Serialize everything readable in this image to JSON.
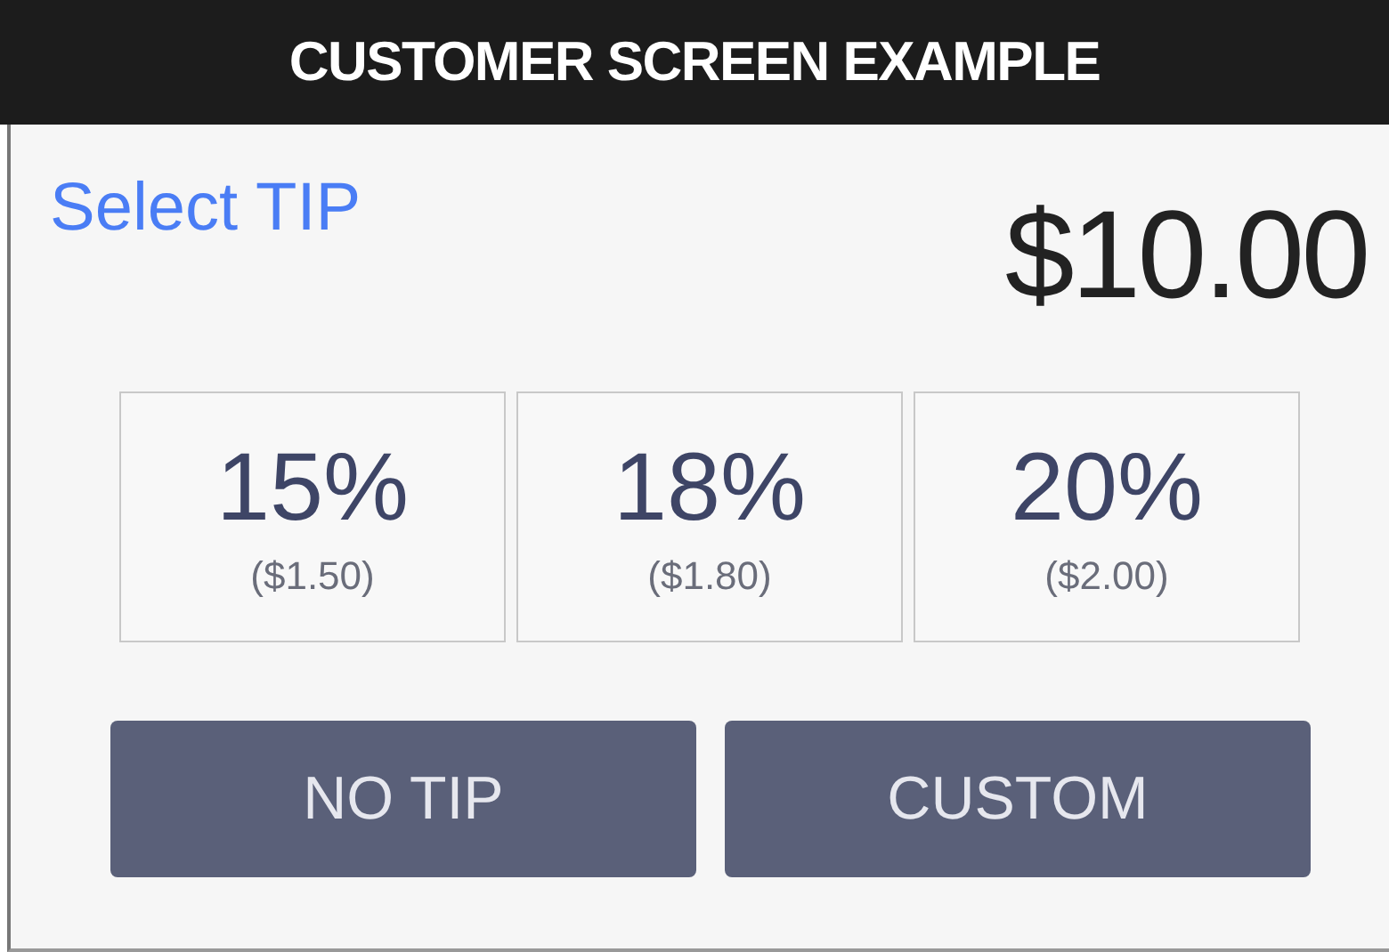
{
  "header": {
    "title": "CUSTOMER SCREEN EXAMPLE"
  },
  "prompt": "Select TIP",
  "amount": "$10.00",
  "tip_options": [
    {
      "percent": "15%",
      "amount": "($1.50)"
    },
    {
      "percent": "18%",
      "amount": "($1.80)"
    },
    {
      "percent": "20%",
      "amount": "($2.00)"
    }
  ],
  "actions": [
    "NO TIP",
    "CUSTOM"
  ]
}
